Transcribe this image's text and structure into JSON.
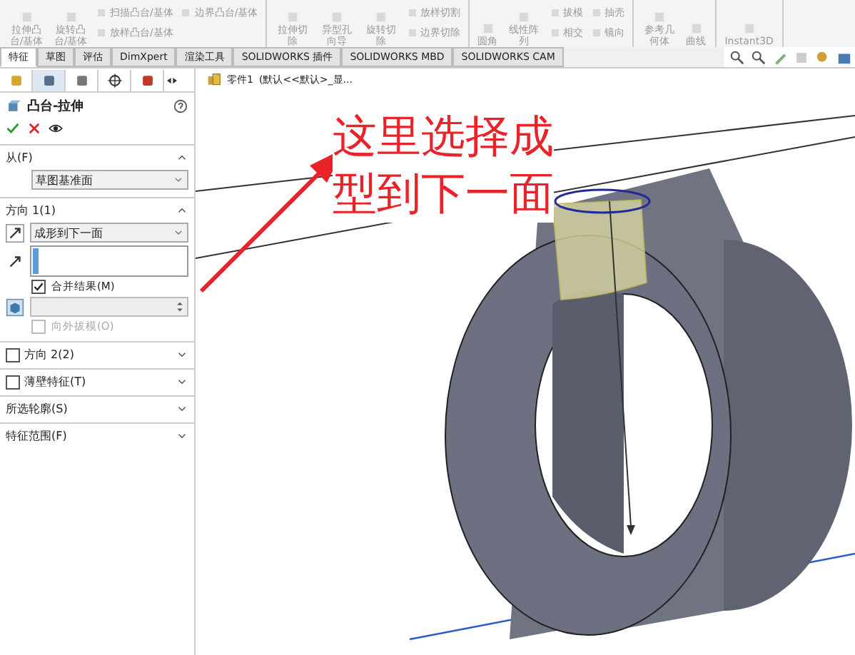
{
  "ribbon": {
    "groups": [
      {
        "items": [
          {
            "label": "拉伸凸台/基体",
            "kind": "large"
          },
          {
            "label": "旋转凸台/基体",
            "kind": "large"
          },
          {
            "label": "扫描凸台/基体",
            "kind": "small"
          },
          {
            "label": "放样凸台/基体",
            "kind": "small"
          },
          {
            "label": "边界凸台/基体",
            "kind": "small"
          }
        ]
      },
      {
        "items": [
          {
            "label": "拉伸切除",
            "kind": "large"
          },
          {
            "label": "异型孔向导",
            "kind": "large"
          },
          {
            "label": "旋转切除",
            "kind": "large"
          },
          {
            "label": "放样切割",
            "kind": "small"
          },
          {
            "label": "边界切除",
            "kind": "small"
          }
        ]
      },
      {
        "items": [
          {
            "label": "圆角",
            "kind": "large"
          },
          {
            "label": "线性阵列",
            "kind": "large"
          },
          {
            "label": "拔模",
            "kind": "small"
          },
          {
            "label": "相交",
            "kind": "small"
          },
          {
            "label": "抽壳",
            "kind": "small"
          },
          {
            "label": "镜向",
            "kind": "small"
          }
        ]
      },
      {
        "items": [
          {
            "label": "参考几何体",
            "kind": "large"
          },
          {
            "label": "曲线",
            "kind": "large"
          }
        ]
      },
      {
        "items": [
          {
            "label": "Instant3D",
            "kind": "large"
          }
        ]
      }
    ]
  },
  "tabs": [
    {
      "label": "特征",
      "selected": true
    },
    {
      "label": "草图",
      "selected": false
    },
    {
      "label": "评估",
      "selected": false
    },
    {
      "label": "DimXpert",
      "selected": false
    },
    {
      "label": "渲染工具",
      "selected": false
    },
    {
      "label": "SOLIDWORKS 插件",
      "selected": false
    },
    {
      "label": "SOLIDWORKS MBD",
      "selected": false
    },
    {
      "label": "SOLIDWORKS CAM",
      "selected": false
    }
  ],
  "panel": {
    "title": "凸台-拉伸",
    "sections": [
      {
        "label": "从(F)",
        "kind": "open",
        "dropdown": "草图基准面"
      },
      {
        "label": "方向 1(1)",
        "kind": "direction",
        "dropdown": "成形到下一面",
        "merge": {
          "label": "合并结果(M)",
          "checked": true
        },
        "draft": {
          "label": "向外拔模(O)",
          "checked": false,
          "disabled": true
        }
      },
      {
        "label": "方向 2(2)",
        "kind": "checkbox",
        "checked": false
      },
      {
        "label": "薄壁特征(T)",
        "kind": "checkbox",
        "checked": false
      },
      {
        "label": "所选轮廓(S)",
        "kind": "closed"
      },
      {
        "label": "特征范围(F)",
        "kind": "closed"
      }
    ]
  },
  "tree": {
    "item": "零件1",
    "config": "(默认<<默认>_显..."
  },
  "annotation": {
    "text": "这里选择成型到下一面"
  }
}
